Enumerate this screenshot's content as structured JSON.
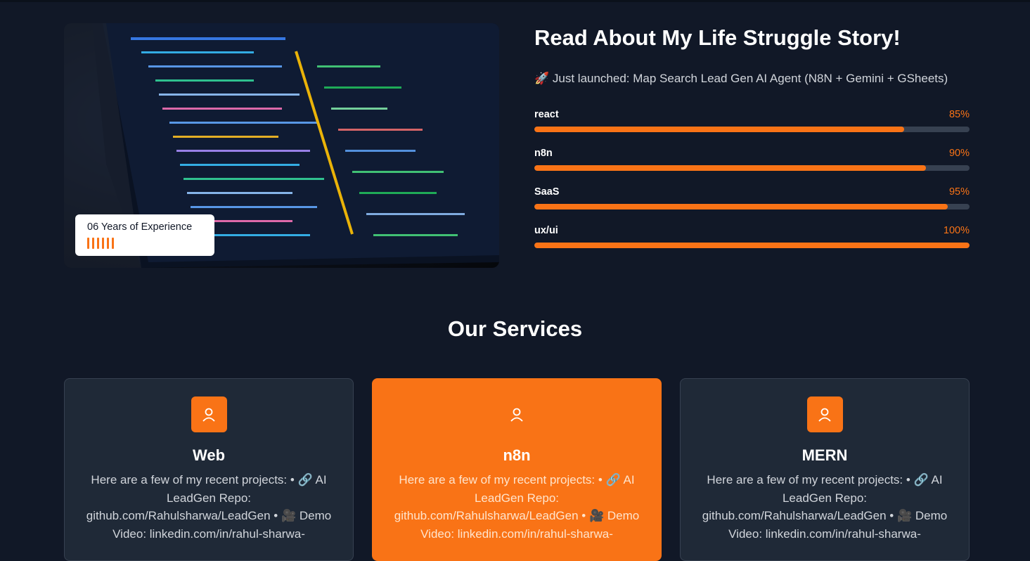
{
  "about": {
    "title": "Read About My Life Struggle Story!",
    "launch": "🚀 Just launched: Map Search Lead Gen AI Agent (N8N + Gemini + GSheets)",
    "experience": "06 Years of Experience",
    "skills": [
      {
        "name": "react",
        "percent_label": "85%",
        "level": 0.85
      },
      {
        "name": "n8n",
        "percent_label": "90%",
        "level": 0.9
      },
      {
        "name": "SaaS",
        "percent_label": "95%",
        "level": 0.95
      },
      {
        "name": "ux/ui",
        "percent_label": "100%",
        "level": 1.0
      }
    ]
  },
  "services": {
    "title": "Our Services",
    "cards": [
      {
        "title": "Web",
        "icon": "user-icon",
        "description": "Here are a few of my recent projects: • 🔗 AI LeadGen Repo: github.com/Rahulsharwa/LeadGen • 🎥 Demo Video: linkedin.com/in/rahul-sharwa-"
      },
      {
        "title": "n8n",
        "icon": "user-icon",
        "description": "Here are a few of my recent projects: • 🔗 AI LeadGen Repo: github.com/Rahulsharwa/LeadGen • 🎥 Demo Video: linkedin.com/in/rahul-sharwa-"
      },
      {
        "title": "MERN",
        "icon": "user-icon",
        "description": "Here are a few of my recent projects: • 🔗 AI LeadGen Repo: github.com/Rahulsharwa/LeadGen • 🎥 Demo Video: linkedin.com/in/rahul-sharwa-"
      }
    ]
  },
  "colors": {
    "accent": "#f97316",
    "background": "#111827",
    "card": "#1f2937"
  }
}
